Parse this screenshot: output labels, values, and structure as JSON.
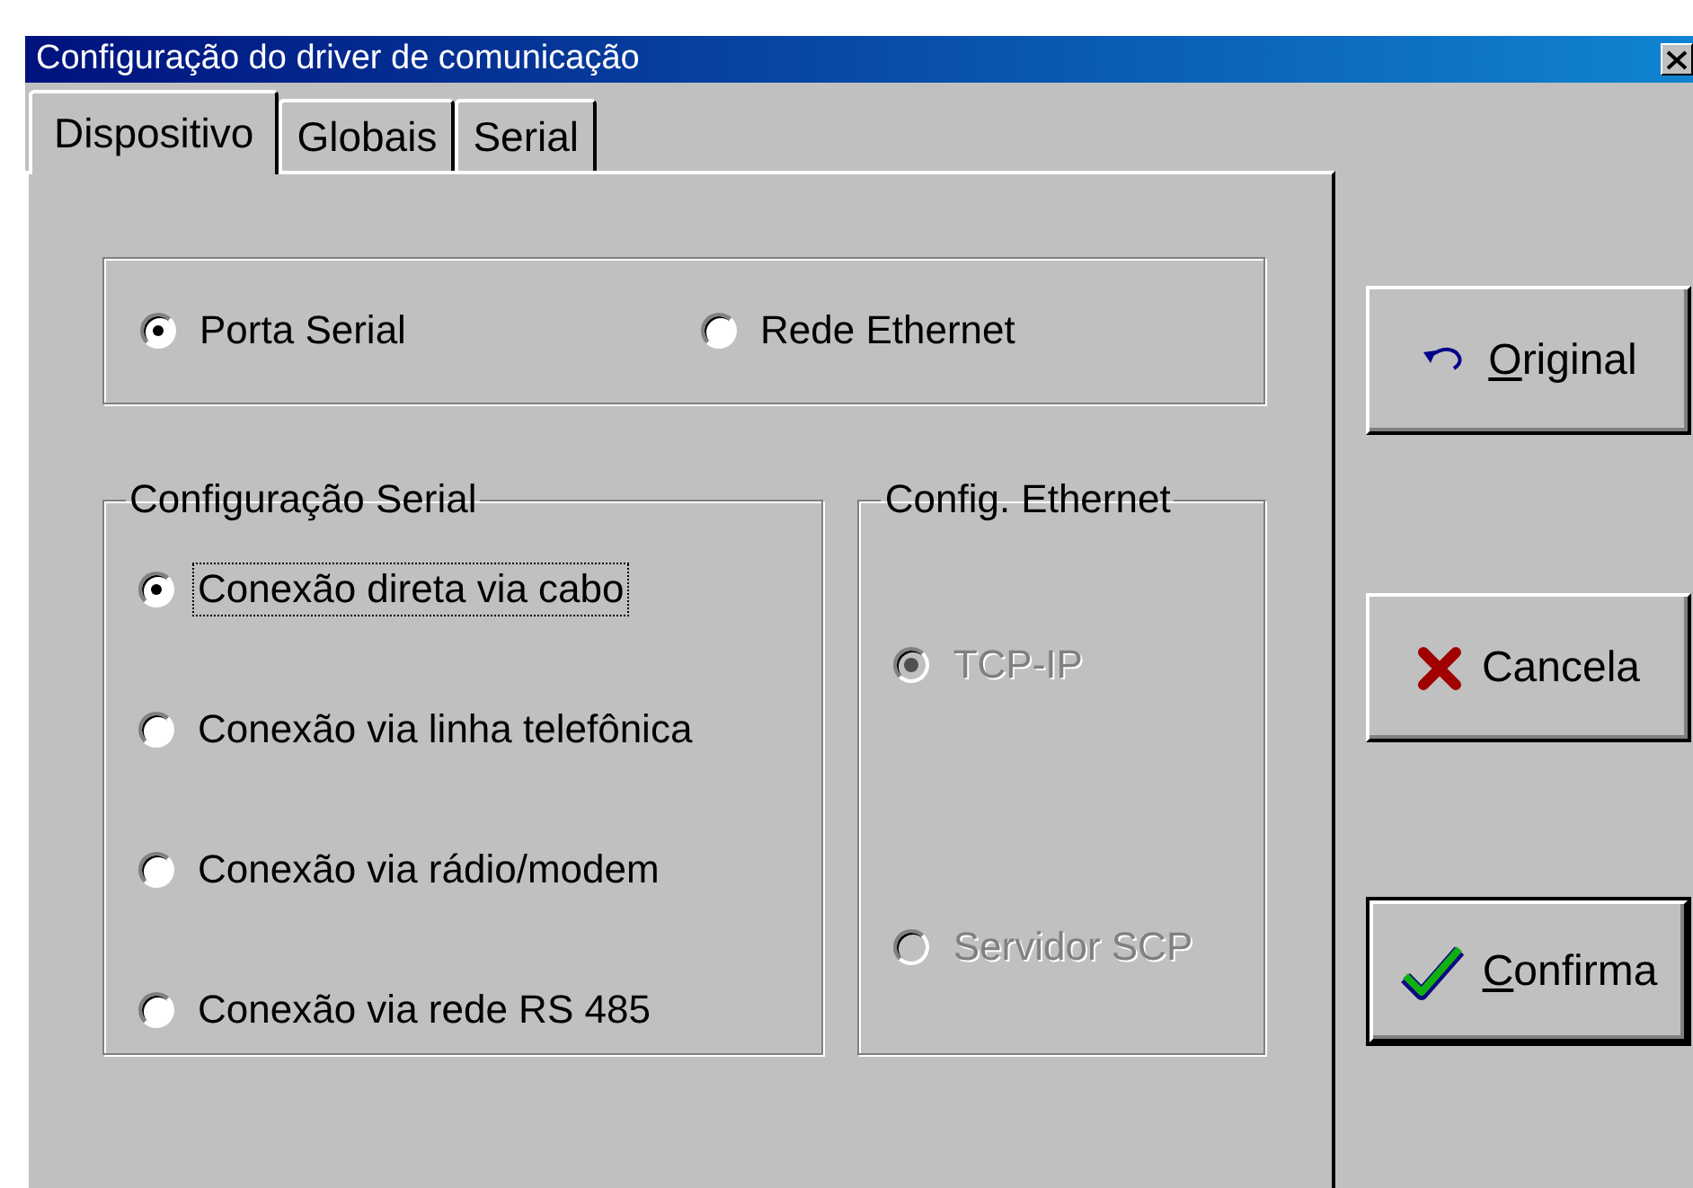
{
  "window": {
    "title": "Configuração do driver de comunicação"
  },
  "tabs": [
    {
      "label": "Dispositivo",
      "selected": true
    },
    {
      "label": "Globais",
      "selected": false
    },
    {
      "label": "Serial",
      "selected": false
    }
  ],
  "connection": {
    "options": [
      {
        "label": "Porta Serial",
        "selected": true,
        "disabled": false,
        "focused": false
      },
      {
        "label": "Rede Ethernet",
        "selected": false,
        "disabled": false,
        "focused": false
      }
    ]
  },
  "groups": [
    {
      "title": "Configuração Serial",
      "options": [
        {
          "label": "Conexão direta via cabo",
          "selected": true,
          "disabled": false,
          "focused": true
        },
        {
          "label": "Conexão via linha telefônica",
          "selected": false,
          "disabled": false,
          "focused": false
        },
        {
          "label": "Conexão via rádio/modem",
          "selected": false,
          "disabled": false,
          "focused": false
        },
        {
          "label": "Conexão via rede RS 485",
          "selected": false,
          "disabled": false,
          "focused": false
        }
      ]
    },
    {
      "title": "Config. Ethernet",
      "options": [
        {
          "label": "TCP-IP",
          "selected": true,
          "disabled": true,
          "focused": false
        },
        {
          "label": "Servidor SCP",
          "selected": false,
          "disabled": true,
          "focused": false
        }
      ]
    }
  ],
  "buttons": [
    {
      "label": "Original",
      "kind": "undo",
      "underline_first": true,
      "default": false
    },
    {
      "label": "Cancela",
      "kind": "cancel",
      "underline_first": false,
      "default": false
    },
    {
      "label": "Confirma",
      "kind": "confirm",
      "underline_first": true,
      "default": true
    }
  ]
}
